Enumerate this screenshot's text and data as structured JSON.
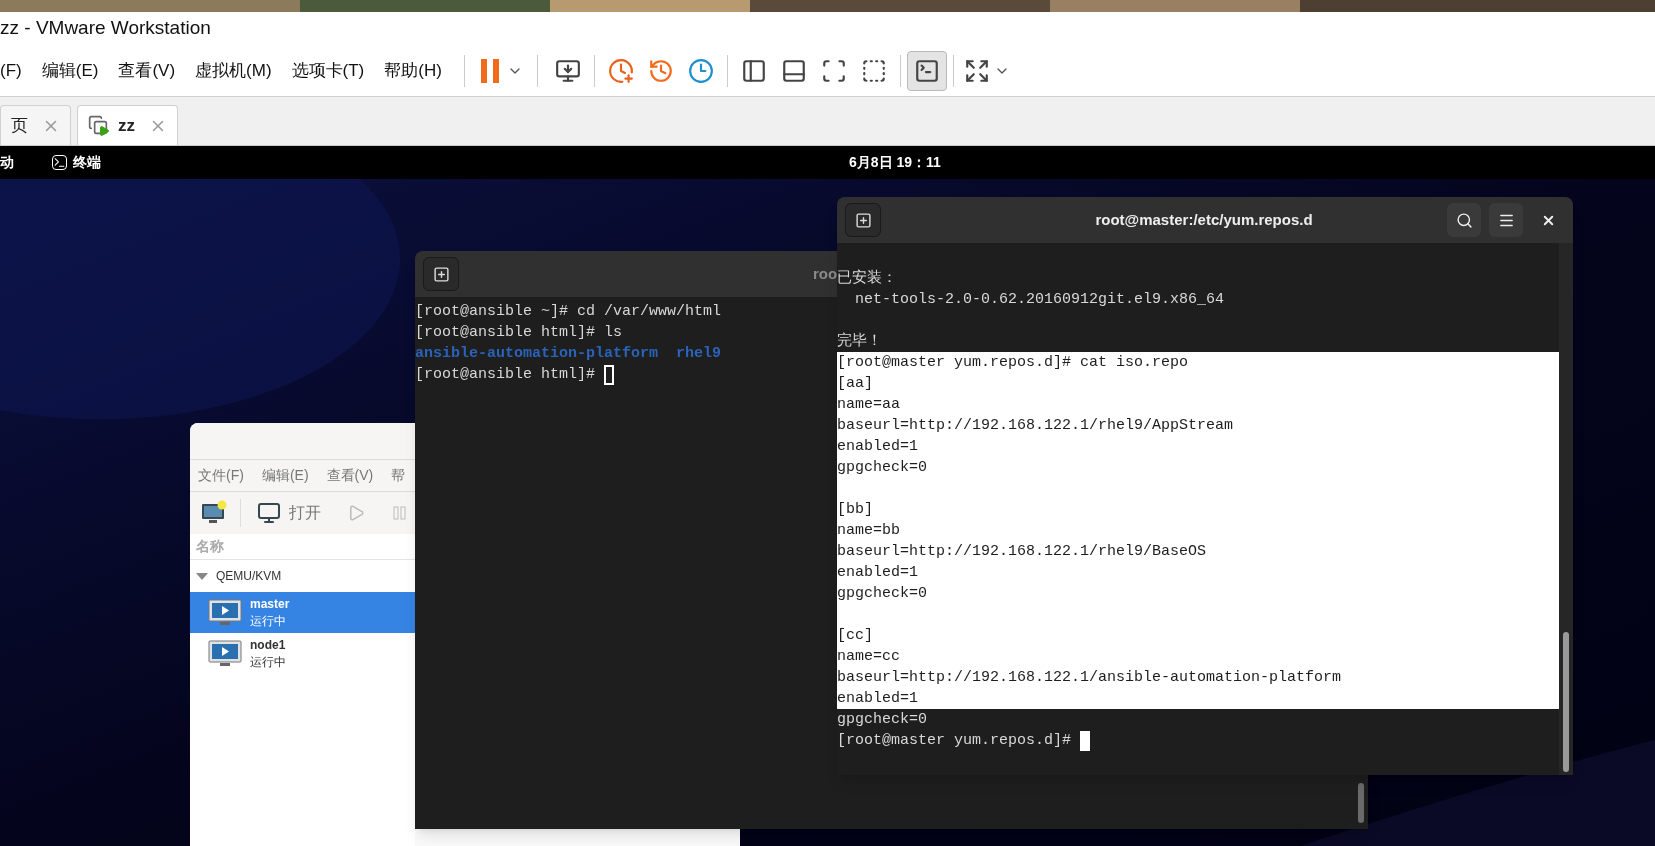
{
  "window": {
    "title": "zz - VMware Workstation"
  },
  "menu": [
    "(F)",
    "编辑(E)",
    "查看(V)",
    "虚拟机(M)",
    "选项卡(T)",
    "帮助(H)"
  ],
  "console_toggle": {
    "pressed": true
  },
  "tabs": [
    {
      "label": "页",
      "selected": false
    },
    {
      "label": "zz",
      "selected": true
    }
  ],
  "guest_topbar": {
    "activities": "动",
    "app": "终端",
    "clock": "6月8日 19：11"
  },
  "vm_manager": {
    "menu": [
      "文件(F)",
      "编辑(E)",
      "查看(V)",
      "帮"
    ],
    "open_button": "打开",
    "column": "名称",
    "tree": [
      {
        "label": "QEMU/KVM",
        "expanded": true,
        "children": [
          {
            "name": "master",
            "status": "运行中",
            "selected": true
          },
          {
            "name": "node1",
            "status": "运行中",
            "selected": false
          }
        ]
      }
    ]
  },
  "terminal_back": {
    "title": "roo",
    "focused": false,
    "lines": [
      {
        "kind": "text",
        "text": "[root@ansible ~]# cd /var/www/html",
        "selected": false
      },
      {
        "kind": "text",
        "text": "[root@ansible html]# ls",
        "selected": false
      },
      {
        "kind": "dir",
        "text": "ansible-automation-platform  rhel9",
        "selected": false
      },
      {
        "kind": "text",
        "text": "[root@ansible html]# ",
        "selected": false
      }
    ]
  },
  "terminal_front": {
    "title": "root@master:/etc/yum.repos.d",
    "focused": true,
    "lines": [
      {
        "kind": "blank",
        "selected": false
      },
      {
        "kind": "text",
        "text": "已安装：",
        "selected": false
      },
      {
        "kind": "text",
        "text": "  net-tools-2.0-0.62.20160912git.el9.x86_64",
        "selected": false
      },
      {
        "kind": "blank",
        "selected": false
      },
      {
        "kind": "text",
        "text": "完毕！",
        "selected": false
      },
      {
        "kind": "text",
        "text": "[root@master yum.repos.d]# cat iso.repo",
        "selected": true
      },
      {
        "kind": "text",
        "text": "[aa]",
        "selected": true
      },
      {
        "kind": "text",
        "text": "name=aa",
        "selected": true
      },
      {
        "kind": "text",
        "text": "baseurl=http://192.168.122.1/rhel9/AppStream",
        "selected": true
      },
      {
        "kind": "text",
        "text": "enabled=1",
        "selected": true
      },
      {
        "kind": "text",
        "text": "gpgcheck=0",
        "selected": true
      },
      {
        "kind": "blank",
        "selected": true
      },
      {
        "kind": "text",
        "text": "[bb]",
        "selected": true
      },
      {
        "kind": "text",
        "text": "name=bb",
        "selected": true
      },
      {
        "kind": "text",
        "text": "baseurl=http://192.168.122.1/rhel9/BaseOS",
        "selected": true
      },
      {
        "kind": "text",
        "text": "enabled=1",
        "selected": true
      },
      {
        "kind": "text",
        "text": "gpgcheck=0",
        "selected": true
      },
      {
        "kind": "blank",
        "selected": true
      },
      {
        "kind": "text",
        "text": "[cc]",
        "selected": true
      },
      {
        "kind": "text",
        "text": "name=cc",
        "selected": true
      },
      {
        "kind": "text",
        "text": "baseurl=http://192.168.122.1/ansible-automation-platform",
        "selected": true
      },
      {
        "kind": "text",
        "text": "enabled=1",
        "selected": true
      },
      {
        "kind": "text",
        "text": "gpgcheck=0",
        "selected": false
      },
      {
        "kind": "text",
        "text": "[root@master yum.repos.d]# ",
        "selected": false
      }
    ]
  }
}
